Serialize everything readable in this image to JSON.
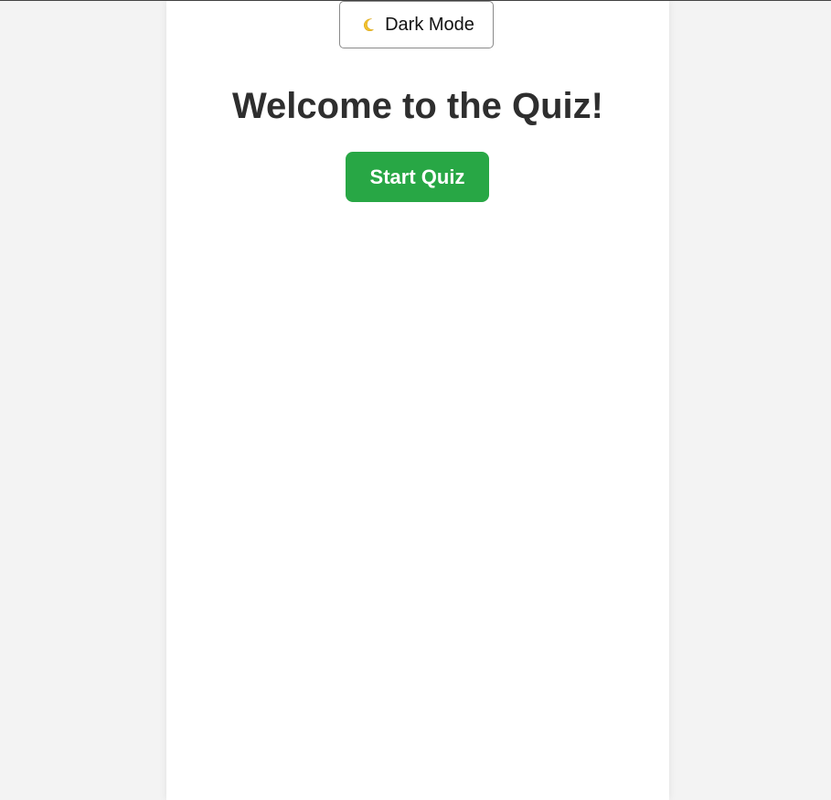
{
  "theme_toggle": {
    "icon": "crescent-moon-icon",
    "label": "Dark Mode"
  },
  "title": "Welcome to the Quiz!",
  "start_button": {
    "label": "Start Quiz"
  },
  "colors": {
    "page_background": "#f3f3f3",
    "card_background": "#ffffff",
    "accent_green": "#28a745",
    "title_text": "#2e2e2e",
    "moon": "#f2c12e"
  }
}
